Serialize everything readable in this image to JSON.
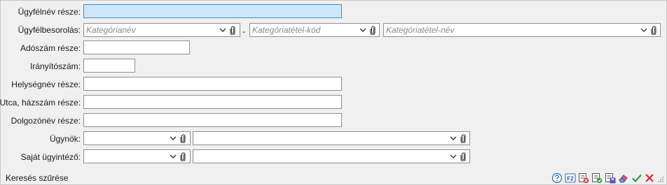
{
  "form": {
    "customer_name_label": "Ügyfélnév része:",
    "customer_class_label": "Ügyfélbesorolás:",
    "category_name_placeholder": "Kategórianév",
    "separator": "-",
    "category_item_code_placeholder": "Kategóriatétel-kód",
    "category_item_name_placeholder": "Kategóriatétel-név",
    "tax_number_label": "Adószám része:",
    "zip_label": "Irányítószám:",
    "city_label": "Helységnév része:",
    "street_label": "Utca, házszám része:",
    "employee_label": "Dolgozónév része:",
    "agents_label": "Ügynök:",
    "own_admin_label": "Saját ügyintéző:"
  },
  "status": {
    "title": "Keresés szűrése"
  },
  "toolbar": {
    "icons": [
      "help-icon",
      "f2-key-icon",
      "clear-filter-icon",
      "apply-filter-icon",
      "save-filter-icon",
      "eraser-icon",
      "ok-check-icon",
      "cancel-x-icon",
      "resize-grip-icon"
    ],
    "f2_label": "F2"
  },
  "colors": {
    "focus_fill": "#cde8fa",
    "focus_border": "#3a8fd3",
    "ok_green": "#2e9e3e",
    "cancel_red": "#d93030",
    "help_blue": "#2f6fbf"
  }
}
